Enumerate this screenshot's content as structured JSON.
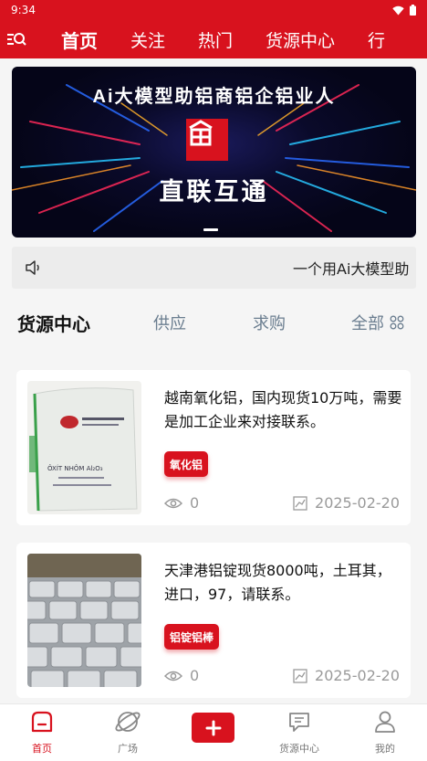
{
  "status_bar": {
    "time": "9:34"
  },
  "top_nav": {
    "tabs": [
      {
        "label": "首页",
        "active": true
      },
      {
        "label": "关注",
        "active": false
      },
      {
        "label": "热门",
        "active": false
      },
      {
        "label": "货源中心",
        "active": false
      },
      {
        "label": "行",
        "active": false
      }
    ]
  },
  "banner": {
    "title": "Ai大模型助铝商铝企铝业人",
    "subtitle": "直联互通"
  },
  "notice": {
    "text": "一个用Ai大模型助"
  },
  "section": {
    "title": "货源中心",
    "filters": {
      "supply": "供应",
      "demand": "求购",
      "all": "全部"
    }
  },
  "cards": [
    {
      "title": "越南氧化铝，国内现货10万吨，需要是加工企业来对接联系。",
      "tag": "氧化铝",
      "views": "0",
      "date": "2025-02-20",
      "image_label": "ÔXÍT NHÔM Al₂O₃"
    },
    {
      "title": "天津港铝锭现货8000吨，土耳其，进口，97，请联系。",
      "tag": "铝锭铝棒",
      "views": "0",
      "date": "2025-02-20"
    }
  ],
  "bottom_nav": {
    "home": "首页",
    "plaza": "广场",
    "supply_center": "货源中心",
    "mine": "我的"
  },
  "colors": {
    "brand_red": "#d8121e",
    "muted": "#9a9a9a",
    "filter_gray": "#6a7d8f"
  }
}
